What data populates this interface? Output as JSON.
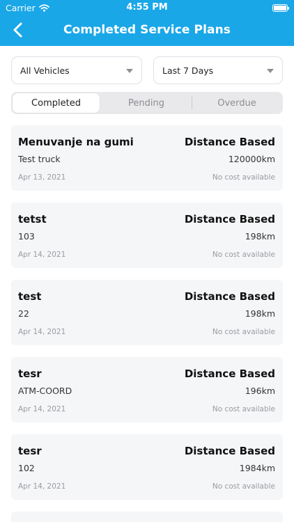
{
  "status_bar": {
    "carrier": "Carrier",
    "time": "4:55 PM"
  },
  "header": {
    "title": "Completed Service Plans"
  },
  "filters": {
    "vehicle": "All Vehicles",
    "period": "Last 7 Days"
  },
  "tabs": [
    {
      "label": "Completed",
      "selected": true
    },
    {
      "label": "Pending",
      "selected": false
    },
    {
      "label": "Overdue",
      "selected": false
    }
  ],
  "plans": [
    {
      "name": "Menuvanje na gumi",
      "type": "Distance Based",
      "vehicle": "Test truck",
      "distance": "120000km",
      "date": "Apr 13, 2021",
      "cost": "No cost available"
    },
    {
      "name": "tetst",
      "type": "Distance Based",
      "vehicle": "103",
      "distance": "198km",
      "date": "Apr 14, 2021",
      "cost": "No cost available"
    },
    {
      "name": "test",
      "type": "Distance Based",
      "vehicle": "22",
      "distance": "198km",
      "date": "Apr 14, 2021",
      "cost": "No cost available"
    },
    {
      "name": "tesr",
      "type": "Distance Based",
      "vehicle": "ATM-COORD",
      "distance": "196km",
      "date": "Apr 14, 2021",
      "cost": "No cost available"
    },
    {
      "name": "tesr",
      "type": "Distance Based",
      "vehicle": "102",
      "distance": "1984km",
      "date": "Apr 14, 2021",
      "cost": "No cost available"
    }
  ],
  "colors": {
    "header": "#1aa7e8",
    "card": "#f5f6f8",
    "muted_text": "#9a9ba0"
  }
}
